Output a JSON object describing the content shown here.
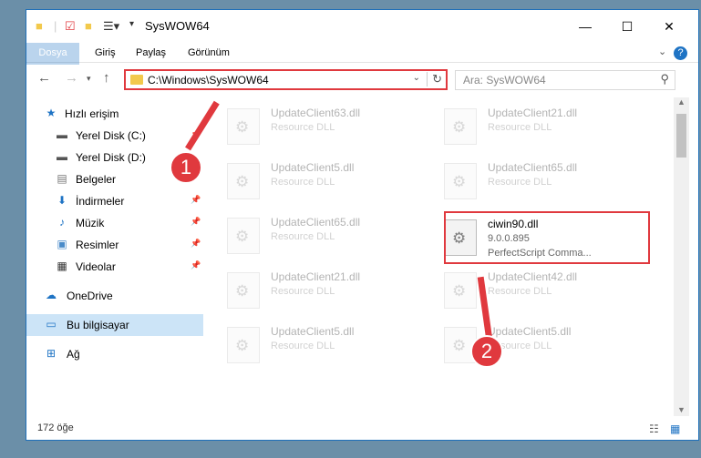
{
  "window": {
    "title": "SysWOW64"
  },
  "ribbon": {
    "tabs": [
      "Dosya",
      "Giriş",
      "Paylaş",
      "Görünüm"
    ]
  },
  "address": {
    "path": "C:\\Windows\\SysWOW64"
  },
  "search": {
    "placeholder": "Ara: SysWOW64"
  },
  "sidebar": {
    "items": [
      {
        "label": "Hızlı erişim",
        "icon": "star-icon"
      },
      {
        "label": "Yerel Disk (C:)",
        "icon": "drive-icon"
      },
      {
        "label": "Yerel Disk (D:)",
        "icon": "drive-icon"
      },
      {
        "label": "Belgeler",
        "icon": "document-icon"
      },
      {
        "label": "İndirmeler",
        "icon": "download-icon"
      },
      {
        "label": "Müzik",
        "icon": "music-icon"
      },
      {
        "label": "Resimler",
        "icon": "picture-icon"
      },
      {
        "label": "Videolar",
        "icon": "video-icon"
      },
      {
        "label": "OneDrive",
        "icon": "cloud-icon"
      },
      {
        "label": "Bu bilgisayar",
        "icon": "computer-icon"
      },
      {
        "label": "Ağ",
        "icon": "network-icon"
      }
    ]
  },
  "files": [
    {
      "name": "UpdateClient63.dll",
      "desc": "Resource DLL"
    },
    {
      "name": "UpdateClient21.dll",
      "desc": "Resource DLL"
    },
    {
      "name": "UpdateClient5.dll",
      "desc": "Resource DLL"
    },
    {
      "name": "UpdateClient65.dll",
      "desc": "Resource DLL"
    },
    {
      "name": "UpdateClient65.dll",
      "desc": "Resource DLL"
    },
    {
      "name": "ciwin90.dll",
      "version": "9.0.0.895",
      "desc": "PerfectScript Comma..."
    },
    {
      "name": "UpdateClient21.dll",
      "desc": "Resource DLL"
    },
    {
      "name": "UpdateClient42.dll",
      "desc": "Resource DLL"
    },
    {
      "name": "UpdateClient5.dll",
      "desc": "Resource DLL"
    },
    {
      "name": "UpdateClient5.dll",
      "desc": "Resource DLL"
    }
  ],
  "callouts": [
    "1",
    "2"
  ],
  "status": {
    "count": "172 öğe"
  },
  "colors": {
    "accent": "#1e73c4",
    "highlight": "#e0393e",
    "selected": "#cce4f7"
  }
}
